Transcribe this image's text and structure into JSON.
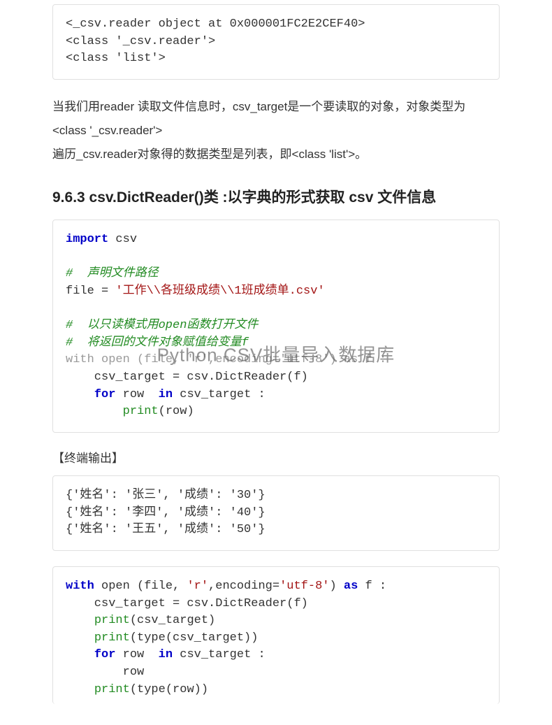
{
  "block1": {
    "l1": "<_csv.reader object at 0x000001FC2E2CEF40>",
    "l2": "<class '_csv.reader'>",
    "l3": "<class 'list'>"
  },
  "para1": {
    "l1": "当我们用reader 读取文件信息时，csv_target是一个要读取的对象，对象类型为",
    "l2": "<class '_csv.reader'>",
    "l3": "遍历_csv.reader对象得的数据类型是列表，即<class 'list'>。"
  },
  "heading": "9.6.3 csv.DictReader()类 :以字典的形式获取 csv 文件信息",
  "block2": {
    "kw_import": "import",
    "csv": " csv",
    "c1": "#  声明文件路径",
    "file_eq": "file = ",
    "file_str": "'工作\\\\各班级成绩\\\\1班成绩单.csv'",
    "c2": "#  以只读模式用open函数打开文件",
    "c3": "#  将返回的文件对象赋值给变量f",
    "with_gray": "with open (file, 'r',encoding='utf-8') as f :",
    "l_csvtarget": "    csv_target = csv.DictReader(f)",
    "kw_for": "for",
    "for_rest": " row  ",
    "kw_in": "in",
    "in_rest": " csv_target :",
    "print_indent": "        ",
    "print_kw": "print",
    "print_arg": "(row)",
    "indent4": "    "
  },
  "sublabel": "【终端输出】",
  "block3": {
    "l1": "{'姓名': '张三', '成绩': '30'}",
    "l2": "{'姓名': '李四', '成绩': '40'}",
    "l3": "{'姓名': '王五', '成绩': '50'}"
  },
  "block4": {
    "kw_with": "with",
    "open_part": " open (file, ",
    "str_r": "'r'",
    "enc_part": ",encoding=",
    "str_utf": "'utf-8'",
    "close_paren": ") ",
    "kw_as": "as",
    "as_f": " f :",
    "l_csvtarget": "    csv_target = csv.DictReader(f)",
    "indent4": "    ",
    "print_kw": "print",
    "p1_arg": "(csv_target)",
    "p2_arg": "(type(csv_target))",
    "kw_for": "for",
    "for_rest": " row  ",
    "kw_in": "in",
    "in_rest": " csv_target :",
    "row_line": "        row",
    "p3_arg": "(type(row))"
  },
  "watermark": "Python CSV批量导入数据库"
}
